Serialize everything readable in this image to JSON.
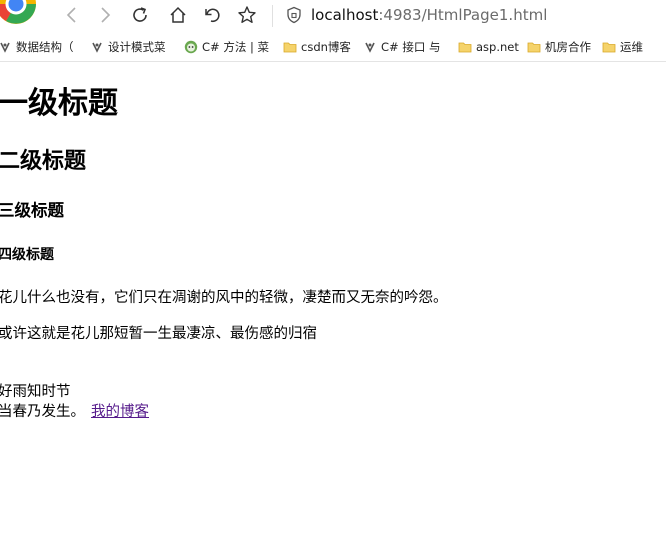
{
  "browser": {
    "url_host": "localhost",
    "url_rest": ":4983/HtmlPage1.html",
    "icons": [
      "browser-logo-icon",
      "back-icon",
      "forward-icon",
      "refresh-icon",
      "home-icon",
      "undo-icon",
      "favorite-star-icon",
      "shield-icon"
    ]
  },
  "bookmarks": [
    {
      "label": "数据结构（",
      "icon": "app-icon"
    },
    {
      "label": "设计模式菜",
      "icon": "app-icon"
    },
    {
      "label": "C# 方法 | 菜",
      "icon": "robot-icon"
    },
    {
      "label": "csdn博客",
      "icon": "folder-icon"
    },
    {
      "label": "C# 接口 与",
      "icon": "app-icon"
    },
    {
      "label": "asp.net",
      "icon": "folder-icon"
    },
    {
      "label": "机房合作",
      "icon": "folder-icon"
    },
    {
      "label": "运维",
      "icon": "folder-icon"
    }
  ],
  "page": {
    "h1": "一级标题",
    "h2": "二级标题",
    "h3": "三级标题",
    "h4": "四级标题",
    "p1": "花儿什么也没有，它们只在凋谢的风中的轻微，凄楚而又无奈的吟怨。",
    "p2": "或许这就是花儿那短暂一生最凄凉、最伤感的归宿",
    "line3": "好雨知时节",
    "line4": "当春乃发生。",
    "link": "我的博客"
  },
  "colors": {
    "link": "#551a8b",
    "folder": "#f5c842",
    "bookmark_border": "#e4e4e4"
  }
}
